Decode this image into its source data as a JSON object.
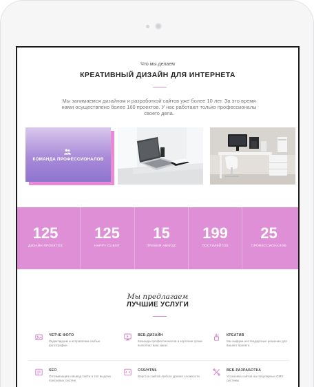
{
  "intro": {
    "kicker": "Что мы делаем",
    "title": "КРЕАТИВНЫЙ ДИЗАЙН ДЛЯ ИНТЕРНЕТА",
    "text": "Мы занимаемся дизайном и разработкой сайтов уже более 10 лет. За это время нами осуществлено более 160 проектов. У нас работают только профессионалы своего дела."
  },
  "team_card": {
    "icon": "team-icon",
    "label": "КОМАНДА ПРОФЕССИОНАЛОВ"
  },
  "photos": [
    {
      "icon": "laptop-photo"
    },
    {
      "icon": "workspace-photo"
    }
  ],
  "stats": [
    {
      "value": "125",
      "label": "ДИЗАЙН ПРОЕКТОВ"
    },
    {
      "value": "125",
      "label": "HAPPY CLIENT"
    },
    {
      "value": "15",
      "label": "ПРЕМИЯ АВАРДС"
    },
    {
      "value": "199",
      "label": "ПОСТИЛЕЙТОВ"
    },
    {
      "value": "25",
      "label": "ПРОФЕССИОНАЛОВ"
    }
  ],
  "services": {
    "script": "Мы предлагаем",
    "title": "ЛУЧШИЕ УСЛУГИ",
    "items": [
      {
        "icon": "photo-icon",
        "name": "ЧЕТЧЕ ФОТО",
        "desc": "Редактируем и исправляем любые фотографии"
      },
      {
        "icon": "webdesign-icon",
        "name": "ВЕБ-ДИЗАЙН",
        "desc": "Команда профессионалов в короткие сроки выполнит ваш заказ"
      },
      {
        "icon": "creative-icon",
        "name": "КРЕАТИВ",
        "desc": "Мы найдем нестандартные решения для вашего проекта"
      },
      {
        "icon": "seo-icon",
        "name": "SEO",
        "desc": "Оптимизация и вывод сайта в топ выдачи поисковых систем"
      },
      {
        "icon": "code-icon",
        "name": "CSS/HTML",
        "desc": "Верстка сайтов любого уровня сложности"
      },
      {
        "icon": "tools-icon",
        "name": "ВЕБ-РАЗРАБОТКА",
        "desc": "Установка сайтов на популярные CMS системы"
      }
    ]
  },
  "colors": {
    "accent": "#de8fd6",
    "team_gradient": "#a98ad8",
    "frame": "#1c1c1c"
  }
}
